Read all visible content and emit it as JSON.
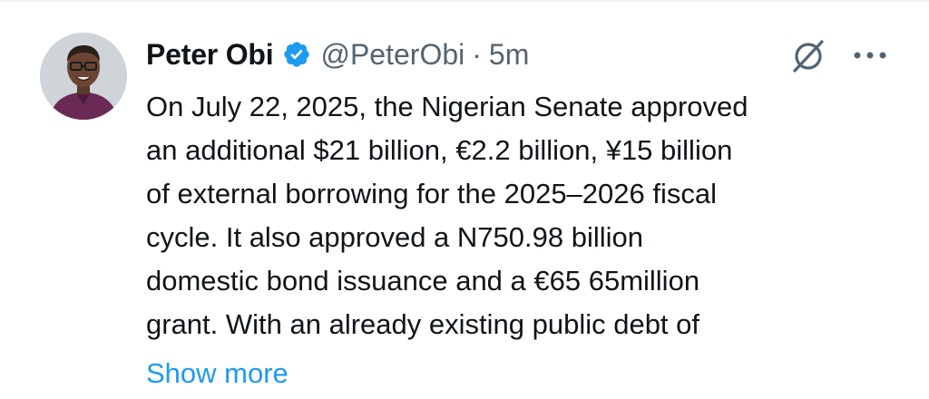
{
  "tweet": {
    "author": {
      "name": "Peter Obi",
      "handle": "@PeterObi",
      "separator": "·",
      "time": "5m",
      "verified": true
    },
    "text_lines": [
      "On July 22, 2025, the Nigerian Senate approved",
      "an additional $21 billion, €2.2 billion, ¥15 billion",
      "of external borrowing for the 2025–2026 fiscal",
      "cycle. It also approved a N750.98 billion",
      "domestic bond issuance and a €65 65million",
      "grant. With an already existing public debt of"
    ],
    "show_more_label": "Show more"
  },
  "icons": {
    "verified": "verified-badge-icon",
    "grok": "grok-icon",
    "more": "more-options-icon"
  },
  "colors": {
    "text_primary": "#0f1419",
    "text_secondary": "#536471",
    "accent": "#1d9bf0"
  }
}
